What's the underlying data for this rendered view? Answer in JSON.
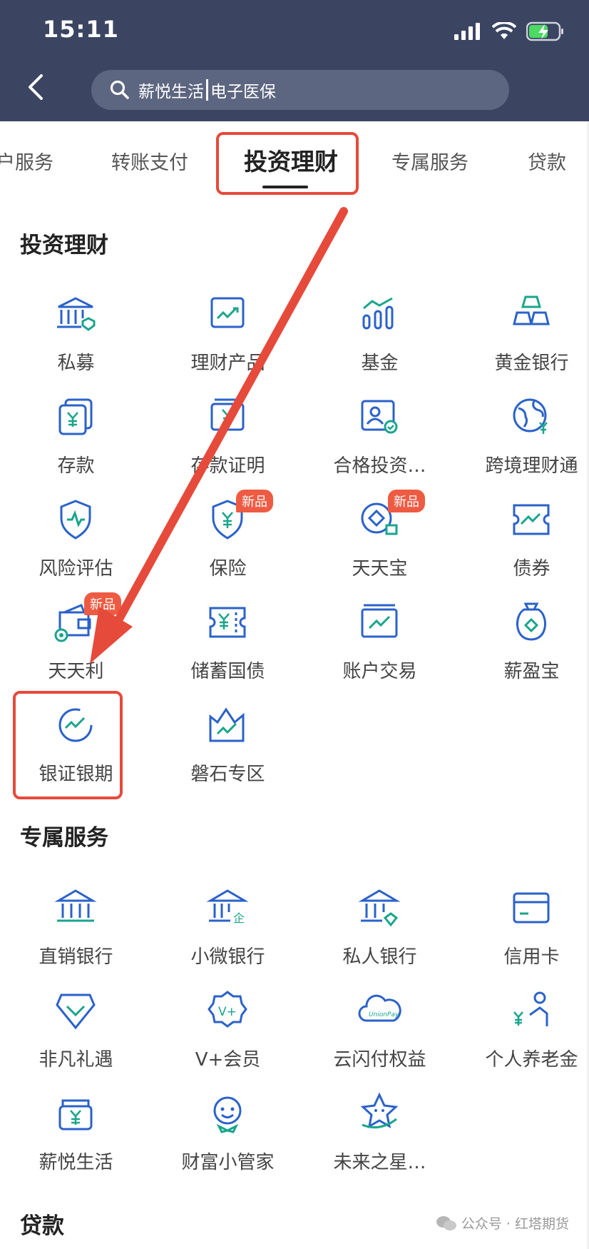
{
  "status_bar": {
    "time": "15:11"
  },
  "search": {
    "prefix": "薪悦生活",
    "suffix": "电子医保"
  },
  "tabs": [
    "户服务",
    "转账支付",
    "投资理财",
    "专属服务",
    "贷款"
  ],
  "sections": {
    "invest": {
      "title": "投资理财",
      "items": [
        {
          "label": "私募",
          "icon": "bank-shield-icon"
        },
        {
          "label": "理财产品",
          "icon": "trend-chart-icon"
        },
        {
          "label": "基金",
          "icon": "bar-chart-icon"
        },
        {
          "label": "黄金银行",
          "icon": "gold-bars-icon"
        },
        {
          "label": "存款",
          "icon": "yuan-card-icon"
        },
        {
          "label": "存款证明",
          "icon": "yuan-certificate-icon"
        },
        {
          "label": "合格投资…",
          "icon": "qualified-investor-icon"
        },
        {
          "label": "跨境理财通",
          "icon": "globe-yuan-icon"
        },
        {
          "label": "风险评估",
          "icon": "shield-pulse-icon"
        },
        {
          "label": "保险",
          "icon": "shield-yuan-icon",
          "badge": "新品"
        },
        {
          "label": "天天宝",
          "icon": "coin-bag-icon",
          "badge": "新品"
        },
        {
          "label": "债券",
          "icon": "bond-ticket-icon"
        },
        {
          "label": "天天利",
          "icon": "wallet-icon",
          "badge": "新品"
        },
        {
          "label": "储蓄国债",
          "icon": "yuan-ticket-icon"
        },
        {
          "label": "账户交易",
          "icon": "account-chart-icon"
        },
        {
          "label": "薪盈宝",
          "icon": "money-bag-icon"
        },
        {
          "label": "银证银期",
          "icon": "circle-trend-icon"
        },
        {
          "label": "磐石专区",
          "icon": "mountain-chart-icon"
        }
      ]
    },
    "exclusive": {
      "title": "专属服务",
      "items": [
        {
          "label": "直销银行",
          "icon": "bank-icon"
        },
        {
          "label": "小微银行",
          "icon": "bank-enterprise-icon"
        },
        {
          "label": "私人银行",
          "icon": "bank-diamond-icon"
        },
        {
          "label": "信用卡",
          "icon": "credit-card-icon"
        },
        {
          "label": "非凡礼遇",
          "icon": "diamond-icon"
        },
        {
          "label": "V+会员",
          "icon": "vplus-badge-icon"
        },
        {
          "label": "云闪付权益",
          "icon": "unionpay-cloud-icon"
        },
        {
          "label": "个人养老金",
          "icon": "pension-person-icon"
        },
        {
          "label": "薪悦生活",
          "icon": "yuan-bag-icon"
        },
        {
          "label": "财富小管家",
          "icon": "assistant-face-icon"
        },
        {
          "label": "未来之星…",
          "icon": "star-face-icon"
        }
      ]
    },
    "loan": {
      "title": "贷款"
    }
  },
  "watermark": "公众号 · 红塔期货",
  "colors": {
    "header": "#3b4562",
    "icon_blue": "#2b62c9",
    "icon_teal": "#1aa58d",
    "badge": "#ee5b43",
    "highlight": "#e64a3b"
  }
}
